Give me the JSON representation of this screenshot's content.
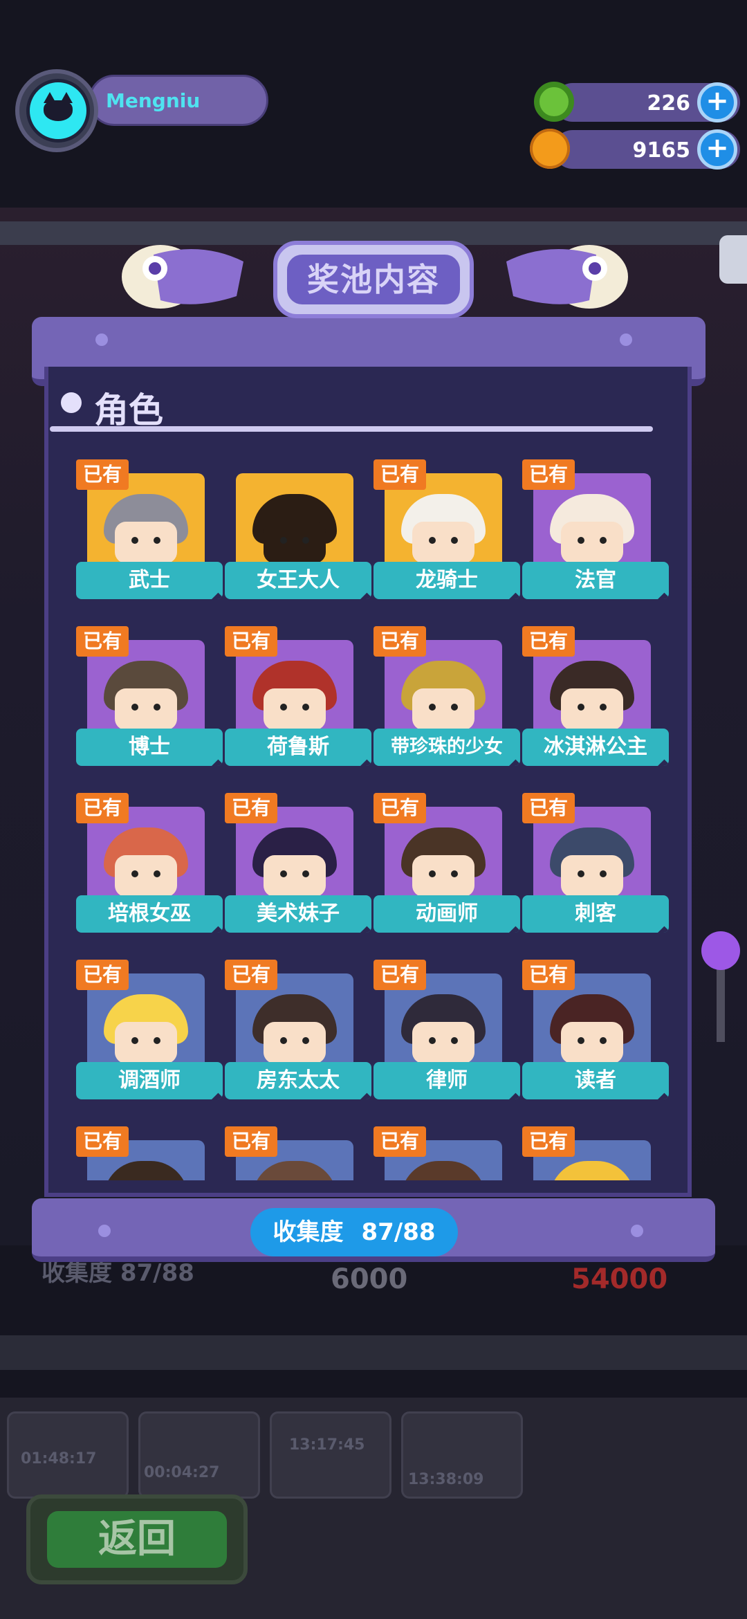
{
  "header": {
    "username": "Mengniu",
    "resources": [
      {
        "name": "donut",
        "value": "226",
        "icon": "green-donut-icon",
        "color": "#6bc23a"
      },
      {
        "name": "coins",
        "value": "9165",
        "icon": "orange-planet-coin-icon",
        "color": "#f39b1b"
      }
    ]
  },
  "panel": {
    "title": "奖池内容",
    "section": "角色",
    "owned_label": "已有",
    "characters": [
      {
        "name": "武士",
        "owned": true,
        "bg": "gold",
        "hair": "#8d8d99"
      },
      {
        "name": "女王大人",
        "owned": false,
        "bg": "gold",
        "hair": "#2b1d14"
      },
      {
        "name": "龙骑士",
        "owned": true,
        "bg": "gold",
        "hair": "#f3f0ea"
      },
      {
        "name": "法官",
        "owned": true,
        "bg": "purple",
        "hair": "#f5eadd"
      },
      {
        "name": "博士",
        "owned": true,
        "bg": "purple",
        "hair": "#5a4a3c"
      },
      {
        "name": "荷鲁斯",
        "owned": true,
        "bg": "purple",
        "hair": "#b0322a"
      },
      {
        "name": "带珍珠的少女",
        "owned": true,
        "bg": "purple",
        "hair": "#c9a43a"
      },
      {
        "name": "冰淇淋公主",
        "owned": true,
        "bg": "purple",
        "hair": "#3a2a26"
      },
      {
        "name": "培根女巫",
        "owned": true,
        "bg": "purple",
        "hair": "#d9674a"
      },
      {
        "name": "美术妹子",
        "owned": true,
        "bg": "purple",
        "hair": "#2a2046"
      },
      {
        "name": "动画师",
        "owned": true,
        "bg": "purple",
        "hair": "#4a3426"
      },
      {
        "name": "刺客",
        "owned": true,
        "bg": "purple",
        "hair": "#3c4a6a"
      },
      {
        "name": "调酒师",
        "owned": true,
        "bg": "blue",
        "hair": "#f7d34a"
      },
      {
        "name": "房东太太",
        "owned": true,
        "bg": "blue",
        "hair": "#3e2e2a"
      },
      {
        "name": "律师",
        "owned": true,
        "bg": "blue",
        "hair": "#2f2a3a"
      },
      {
        "name": "读者",
        "owned": true,
        "bg": "blue",
        "hair": "#4a2424"
      },
      {
        "name": "",
        "owned": true,
        "bg": "blue",
        "hair": "#3a2a20"
      },
      {
        "name": "",
        "owned": true,
        "bg": "blue",
        "hair": "#6a4a3a"
      },
      {
        "name": "",
        "owned": true,
        "bg": "blue",
        "hair": "#5a3a2a"
      },
      {
        "name": "",
        "owned": true,
        "bg": "blue",
        "hair": "#f3c23a"
      }
    ],
    "collection_label": "收集度",
    "collection_value": "87/88"
  },
  "background": {
    "collection_echo": "收集度 87/88",
    "price_a": "6000",
    "price_b": "54000",
    "timers": [
      "01:48:17",
      "00:04:27",
      "13:17:45",
      "13:38:09"
    ],
    "back_label": "返回"
  }
}
